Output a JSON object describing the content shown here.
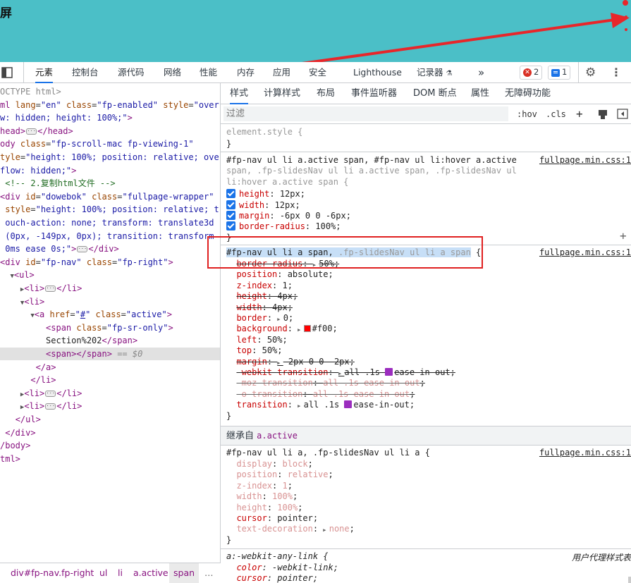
{
  "page": {
    "title_fragment": "屏"
  },
  "toolbar": {
    "tabs": [
      "元素",
      "控制台",
      "源代码",
      "网络",
      "性能",
      "内存",
      "应用",
      "安全",
      "Lighthouse",
      "记录器",
      "»"
    ],
    "active_tab": "元素",
    "error_count": "2",
    "message_count": "1"
  },
  "dom": {
    "lines": [
      {
        "indent": 0,
        "html": "<span class='gr'>OCTYPE html&gt;</span>"
      },
      {
        "indent": 0,
        "html": "<span class='tg'>ml</span> <span class='an'>lang</span>=<span class='av'>\"en\"</span> <span class='an'>class</span>=<span class='av'>\"fp-enabled\"</span> <span class='an'>style</span>=<span class='av'>\"over</span>"
      },
      {
        "indent": 0,
        "html": "<span class='av'>w: hidden; height: 100%;\"</span><span class='tg'>&gt;</span>"
      },
      {
        "indent": 0,
        "html": "<span class='tg'>head&gt;</span><span class='ell'>···</span><span class='tg'>&lt;/head&gt;</span>"
      },
      {
        "indent": 0,
        "html": "<span class='tg'>ody</span> <span class='an'>class</span>=<span class='av'>\"fp-scroll-mac fp-viewing-1\"</span>"
      },
      {
        "indent": 0,
        "html": "<span class='an'>tyle</span>=<span class='av'>\"height: 100%; position: relative; ove</span>"
      },
      {
        "indent": 0,
        "html": "<span class='av'>flow: hidden;\"</span><span class='tg'>&gt;</span>"
      },
      {
        "indent": 0,
        "html": "<span class='cm'> &lt;!-- 2.复制html文件 --&gt;</span>"
      },
      {
        "indent": 0,
        "html": "<span class='tg'>&lt;div</span> <span class='an'>id</span>=<span class='av'>\"dowebok\"</span> <span class='an'>class</span>=<span class='av'>\"fullpage-wrapper\"</span>"
      },
      {
        "indent": 0,
        "html": " <span class='an'>style</span>=<span class='av'>\"height: 100%; position: relative; t</span>"
      },
      {
        "indent": 0,
        "html": " <span class='av'>ouch-action: none; transform: translate3d</span>"
      },
      {
        "indent": 0,
        "html": " <span class='av'>(0px, -149px, 0px); transition: transform</span>"
      },
      {
        "indent": 0,
        "html": " <span class='av'>0ms ease 0s;\"</span><span class='tg'>&gt;</span><span class='ell'>···</span><span class='tg'>&lt;/div&gt;</span>"
      },
      {
        "indent": 0,
        "html": "<span class='tg'>&lt;div</span> <span class='an'>id</span>=<span class='av'>\"fp-nav\"</span> <span class='an'>class</span>=<span class='av'>\"fp-right\"</span><span class='tg'>&gt;</span>"
      },
      {
        "indent": 0,
        "html": "  <span class='tri'>▼</span><span class='tg'>&lt;ul&gt;</span>"
      },
      {
        "indent": 0,
        "html": "    <span class='tri'>▶</span><span class='tg'>&lt;li&gt;</span><span class='ell'>···</span><span class='tg'>&lt;/li&gt;</span>"
      },
      {
        "indent": 0,
        "html": "    <span class='tri'>▼</span><span class='tg'>&lt;li&gt;</span>"
      },
      {
        "indent": 0,
        "html": "      <span class='tri'>▼</span><span class='tg'>&lt;a</span> <span class='an'>href</span>=<span class='av'>\"<u>#</u>\"</span> <span class='an'>class</span>=<span class='av'>\"active\"</span><span class='tg'>&gt;</span>"
      },
      {
        "indent": 0,
        "html": "         <span class='tg'>&lt;span</span> <span class='an'>class</span>=<span class='av'>\"fp-sr-only\"</span><span class='tg'>&gt;</span>"
      },
      {
        "indent": 0,
        "html": "         <span class='tx'>Section%202</span><span class='tg'>&lt;/span&gt;</span>"
      },
      {
        "indent": 0,
        "sel": true,
        "html": "         <span class='tg'>&lt;span&gt;&lt;/span&gt;</span> <span class='gr'>== <i>$0</i></span>"
      },
      {
        "indent": 0,
        "html": "       <span class='tg'>&lt;/a&gt;</span>"
      },
      {
        "indent": 0,
        "html": "      <span class='tg'>&lt;/li&gt;</span>"
      },
      {
        "indent": 0,
        "html": "    <span class='tri'>▶</span><span class='tg'>&lt;li&gt;</span><span class='ell'>···</span><span class='tg'>&lt;/li&gt;</span>"
      },
      {
        "indent": 0,
        "html": "    <span class='tri'>▶</span><span class='tg'>&lt;li&gt;</span><span class='ell'>···</span><span class='tg'>&lt;/li&gt;</span>"
      },
      {
        "indent": 0,
        "html": "   <span class='tg'>&lt;/ul&gt;</span>"
      },
      {
        "indent": 0,
        "html": " <span class='tg'>&lt;/div&gt;</span>"
      },
      {
        "indent": 0,
        "html": "<span class='tg'>/body&gt;</span>"
      },
      {
        "indent": 0,
        "html": "<span class='tg'>tml&gt;</span>"
      }
    ]
  },
  "breadcrumbs": [
    "div#fp-nav.fp-right",
    "ul",
    "li",
    "a.active",
    "span",
    "…"
  ],
  "styles": {
    "subtabs": [
      "样式",
      "计算样式",
      "布局",
      "事件监听器",
      "DOM 断点",
      "属性",
      "无障碍功能"
    ],
    "active_subtab": "样式",
    "filter_placeholder": "过滤",
    "hov": ":hov",
    "cls": ".cls",
    "plus": "+",
    "element_style": "element.style {",
    "close_brace": "}",
    "source": "fullpage.min.css:1",
    "rule1_selector": [
      "#fp-nav ul li a.active span, #fp-nav ul li:hover a.active",
      "span, .fp-slidesNav ul li a.active span, .fp-slidesNav ul",
      "li:hover a.active span {"
    ],
    "rule1_props": [
      {
        "name": "height",
        "value": "12px"
      },
      {
        "name": "width",
        "value": "12px"
      },
      {
        "name": "margin",
        "value": "-6px 0 0 -6px"
      },
      {
        "name": "border-radius",
        "value": "100%"
      }
    ],
    "rule2_selector_main": "#fp-nav ul li a span, ",
    "rule2_selector_dim": ".fp-slidesNav ul li a span",
    "rule2_selector_end": " {",
    "rule2_props": [
      {
        "name": "border-radius",
        "value": "50%",
        "struck": true,
        "arrow": true
      },
      {
        "name": "position",
        "value": "absolute"
      },
      {
        "name": "z-index",
        "value": "1"
      },
      {
        "name": "height",
        "value": "4px",
        "struck": true
      },
      {
        "name": "width",
        "value": "4px",
        "struck": true
      },
      {
        "name": "border",
        "value": "0",
        "arrow": true
      },
      {
        "name": "background",
        "value": "#f00",
        "arrow": true,
        "swatch": "#ff0000"
      },
      {
        "name": "left",
        "value": "50%"
      },
      {
        "name": "top",
        "value": "50%"
      },
      {
        "name": "margin",
        "value": "-2px 0 0 -2px",
        "struck": true,
        "arrow": true
      },
      {
        "name": "-webkit-transition",
        "value": "all .1s ease-in-out",
        "struck": true,
        "arrow": true,
        "ease": true
      },
      {
        "name": "-moz-transition",
        "value": "all .1s ease-in-out",
        "struck": true,
        "dim": true
      },
      {
        "name": "-o-transition",
        "value": "all .1s ease-in-out",
        "struck": true,
        "dim": true
      },
      {
        "name": "transition",
        "value": "all .1s ease-in-out",
        "arrow": true,
        "ease": true
      }
    ],
    "inherited_label": "继承自 ",
    "inherited_from": "a.active",
    "rule3_selector": "#fp-nav ul li a, .fp-slidesNav ul li a {",
    "rule3_props": [
      {
        "name": "display",
        "value": "block",
        "dim": true
      },
      {
        "name": "position",
        "value": "relative",
        "dim": true
      },
      {
        "name": "z-index",
        "value": "1",
        "dim": true
      },
      {
        "name": "width",
        "value": "100%",
        "dim": true
      },
      {
        "name": "height",
        "value": "100%",
        "dim": true
      },
      {
        "name": "cursor",
        "value": "pointer"
      },
      {
        "name": "text-decoration",
        "value": "none",
        "dim": true,
        "arrow": true
      }
    ],
    "rule4_selector": "a:-webkit-any-link {",
    "rule4_source": "用户代理样式表",
    "rule4_props": [
      {
        "name": "color",
        "value": "-webkit-link"
      },
      {
        "name": "cursor",
        "value": "pointer"
      }
    ]
  },
  "colors": {
    "page_bg": "#4bbfc7",
    "accent": "#1a73e8",
    "highlight_box": "#e02020",
    "arrow": "#e8262a"
  }
}
